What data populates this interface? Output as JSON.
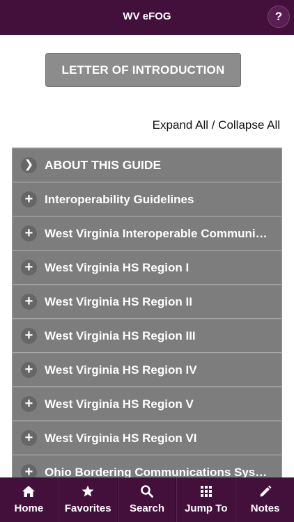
{
  "header": {
    "title": "WV eFOG",
    "help_label": "?"
  },
  "letter_button": "LETTER OF INTRODUCTION",
  "expand_collapse": {
    "expand": "Expand All",
    "separator": " / ",
    "collapse": "Collapse All"
  },
  "sections": [
    {
      "label": "ABOUT THIS GUIDE",
      "icon": "chevron-right-icon"
    },
    {
      "label": "Interoperability Guidelines",
      "icon": "plus-icon"
    },
    {
      "label": "West Virginia Interoperable Communications",
      "icon": "plus-icon"
    },
    {
      "label": "West Virginia HS Region I",
      "icon": "plus-icon"
    },
    {
      "label": "West Virginia HS Region II",
      "icon": "plus-icon"
    },
    {
      "label": "West Virginia HS Region III",
      "icon": "plus-icon"
    },
    {
      "label": "West Virginia HS Region IV",
      "icon": "plus-icon"
    },
    {
      "label": "West Virginia HS Region V",
      "icon": "plus-icon"
    },
    {
      "label": "West Virginia HS Region VI",
      "icon": "plus-icon"
    },
    {
      "label": "Ohio Bordering Communications Systems",
      "icon": "plus-icon"
    }
  ],
  "tabbar": {
    "items": [
      {
        "label": "Home",
        "icon": "home-icon"
      },
      {
        "label": "Favorites",
        "icon": "star-icon"
      },
      {
        "label": "Search",
        "icon": "search-icon"
      },
      {
        "label": "Jump To",
        "icon": "grid-icon"
      },
      {
        "label": "Notes",
        "icon": "pencil-icon"
      }
    ]
  },
  "colors": {
    "brand": "#43103c",
    "list_bg": "#7d7d7d",
    "button_bg": "#8c8c8c"
  }
}
